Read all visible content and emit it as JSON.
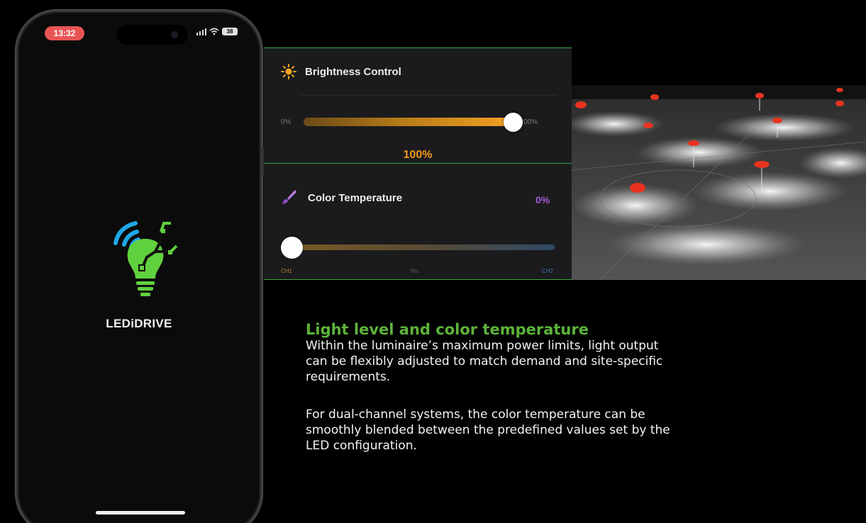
{
  "phone": {
    "status_time": "13:32",
    "battery": "38",
    "brand": "LEDiDRIVE"
  },
  "brightness": {
    "title": "Brightness Control",
    "min_label": "0%",
    "max_label": "00%",
    "value_label": "100%",
    "level": 1.0
  },
  "color_temperature": {
    "title": "Color Temperature",
    "value_label": "0%",
    "ch1_label": "CH1",
    "mid_label": "Mix",
    "ch2_label": "CH2",
    "level": 0.0
  },
  "text": {
    "heading": "Light level and color temperature",
    "para1_line1": "Within the luminaire’s maximum power limits, light output",
    "para1_line2": "can be flexibly adjusted to match demand and site-specific",
    "para1_line3": "requirements.",
    "para2_line1": "For dual-channel systems, the color temperature can be",
    "para2_line2": "smoothly blended between the predefined values set by the",
    "para2_line3": "LED configuration."
  },
  "colors": {
    "accent_green": "#5db33c",
    "brightness_orange": "#f29a1c",
    "temp_purple": "#a45ad8",
    "status_red": "#e95555"
  }
}
